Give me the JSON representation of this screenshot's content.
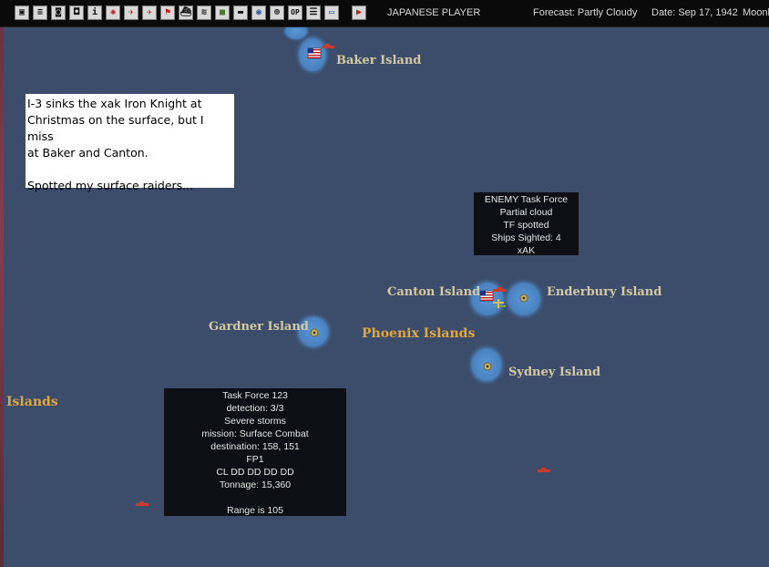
{
  "toolbar": {
    "icons": [
      "save-icon",
      "document-icon",
      "aircraft-group-icon",
      "base-icon",
      "info-icon",
      "japan-flag-icon",
      "fighter-icon",
      "bomber-icon",
      "flag-icon",
      "ship-icon",
      "convoy-icon",
      "land-unit-icon",
      "transport-icon",
      "globe-icon",
      "target-icon",
      "op-icon",
      "list-icon",
      "window-icon",
      "end-turn-icon"
    ],
    "op_label": "OP",
    "info_label": "i",
    "player": "JAPANESE PLAYER",
    "forecast": "Forecast: Partly Cloudy",
    "date": "Date: Sep 17, 1942",
    "moon": "Moonl"
  },
  "map": {
    "islands": [
      {
        "id": "baker",
        "name": "Baker Island"
      },
      {
        "id": "canton",
        "name": "Canton Island"
      },
      {
        "id": "enderbury",
        "name": "Enderbury Island"
      },
      {
        "id": "gardner",
        "name": "Gardner Island"
      },
      {
        "id": "sydney",
        "name": "Sydney Island"
      }
    ],
    "regions": [
      {
        "id": "phoenix",
        "name": "Phoenix Islands"
      },
      {
        "id": "islands-left",
        "name": "Islands"
      }
    ],
    "colors": {
      "ocean": "#3b4d6b",
      "shallow": "#4f86c4",
      "island_label": "#d6c9a2",
      "region_label": "#e0a640"
    }
  },
  "note": {
    "lines": [
      "I-3 sinks the xak Iron Knight at",
      "Christmas on the surface, but I miss",
      "at Baker and Canton.",
      "",
      "Spotted my surface raiders..."
    ]
  },
  "enemy_tf": {
    "lines": [
      "ENEMY Task Force",
      "Partial cloud",
      "TF spotted",
      "Ships Sighted: 4",
      "xAK"
    ]
  },
  "task_force": {
    "lines": [
      "Task Force 123",
      "detection: 3/3",
      "Severe storms",
      "mission: Surface Combat",
      "destination: 158, 151",
      "FP1",
      "CL DD DD DD DD",
      "Tonnage: 15,360",
      "",
      "Range is 105"
    ]
  }
}
